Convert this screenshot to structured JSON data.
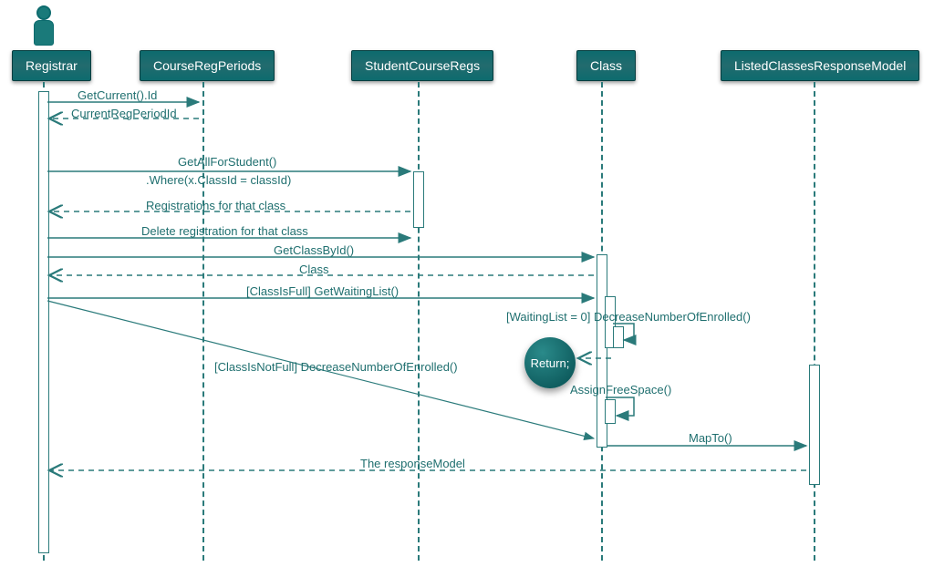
{
  "participants": {
    "actor": "Registrar",
    "p1": "CourseRegPeriods",
    "p2": "StudentCourseRegs",
    "p3": "Class",
    "p4": "ListedClassesResponseModel"
  },
  "messages": {
    "m1": "GetCurrent().Id",
    "m2": "CurrentRegPeriodId",
    "m3a": "GetAllForStudent()",
    "m3b": ".Where(x.ClassId = classId)",
    "m4": "Registrations for that class",
    "m5": "Delete registration for that class",
    "m6": "GetClassById()",
    "m7": "Class",
    "m8": "[ClassIsFull] GetWaitingList()",
    "m9": "[WaitingList = 0] DecreaseNumberOfEnrolled()",
    "m10": "Return;",
    "m11": "AssignFreeSpace()",
    "m12": "[ClassIsNotFull] DecreaseNumberOfEnrolled()",
    "m13": "MapTo()",
    "m14": "The responseModel"
  },
  "colors": {
    "participant_bg": "#0d6b6e",
    "line": "#2a7a7a",
    "text": "#1f6f6f"
  },
  "chart_data": {
    "type": "sequence_diagram",
    "participants": [
      "Registrar",
      "CourseRegPeriods",
      "StudentCourseRegs",
      "Class",
      "ListedClassesResponseModel"
    ],
    "actor": "Registrar",
    "messages": [
      {
        "from": "Registrar",
        "to": "CourseRegPeriods",
        "label": "GetCurrent().Id",
        "type": "call"
      },
      {
        "from": "CourseRegPeriods",
        "to": "Registrar",
        "label": "CurrentRegPeriodId",
        "type": "return"
      },
      {
        "from": "Registrar",
        "to": "StudentCourseRegs",
        "label": "GetAllForStudent().Where(x.ClassId = classId)",
        "type": "call"
      },
      {
        "from": "StudentCourseRegs",
        "to": "Registrar",
        "label": "Registrations for that class",
        "type": "return"
      },
      {
        "from": "Registrar",
        "to": "StudentCourseRegs",
        "label": "Delete registration for that class",
        "type": "call"
      },
      {
        "from": "Registrar",
        "to": "Class",
        "label": "GetClassById()",
        "type": "call"
      },
      {
        "from": "Class",
        "to": "Registrar",
        "label": "Class",
        "type": "return"
      },
      {
        "from": "Registrar",
        "to": "Class",
        "label": "[ClassIsFull] GetWaitingList()",
        "type": "call"
      },
      {
        "from": "Class",
        "to": "Class",
        "label": "[WaitingList = 0] DecreaseNumberOfEnrolled()",
        "type": "self"
      },
      {
        "from": "Class",
        "to": "Registrar",
        "label": "Return;",
        "type": "terminate"
      },
      {
        "from": "Class",
        "to": "Class",
        "label": "AssignFreeSpace()",
        "type": "self"
      },
      {
        "from": "Registrar",
        "to": "Class",
        "label": "[ClassIsNotFull] DecreaseNumberOfEnrolled()",
        "type": "call_diagonal"
      },
      {
        "from": "Class",
        "to": "ListedClassesResponseModel",
        "label": "MapTo()",
        "type": "call"
      },
      {
        "from": "ListedClassesResponseModel",
        "to": "Registrar",
        "label": "The responseModel",
        "type": "return"
      }
    ]
  }
}
